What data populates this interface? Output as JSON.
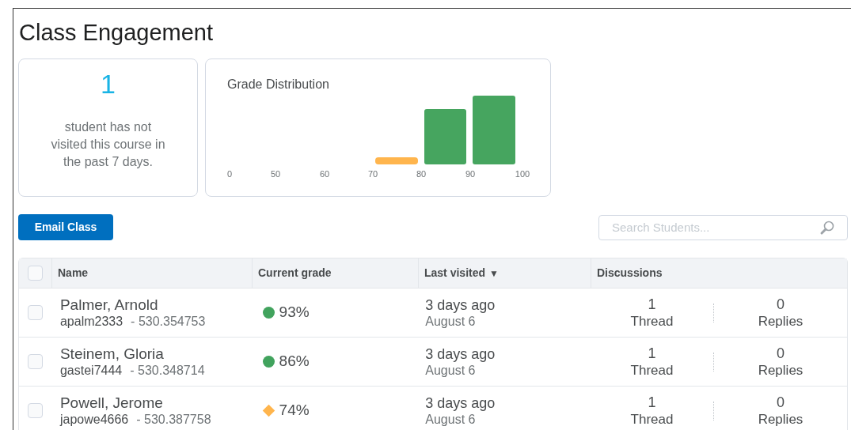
{
  "title": "Class Engagement",
  "inactive_card": {
    "count": "1",
    "text": "student has not visited this course in the past 7 days."
  },
  "grade_distribution": {
    "title": "Grade Distribution",
    "axis_labels": [
      "0",
      "50",
      "60",
      "70",
      "80",
      "90",
      "100"
    ]
  },
  "email_button": "Email Class",
  "search": {
    "placeholder": "Search Students..."
  },
  "table": {
    "select_all_checked": false,
    "columns": [
      {
        "label": "Name"
      },
      {
        "label": "Current grade"
      },
      {
        "label": "Last visited",
        "sort_mark": "▼"
      },
      {
        "label": "Discussions"
      }
    ],
    "rows": [
      {
        "checked": false,
        "name": "Palmer, Arnold",
        "username": "apalm2333",
        "id": "- 530.354753",
        "grade": "93%",
        "kind": "circle",
        "color": "#41a35d",
        "last_relative": "3 days ago",
        "last_date": "August 6",
        "threads": "1",
        "threads_label": "Thread",
        "replies": "0",
        "replies_label": "Replies"
      },
      {
        "checked": false,
        "name": "Steinem, Gloria",
        "username": "gastei7444",
        "id": "- 530.348714",
        "grade": "86%",
        "kind": "circle",
        "color": "#41a35d",
        "last_relative": "3 days ago",
        "last_date": "August 6",
        "threads": "1",
        "threads_label": "Thread",
        "replies": "0",
        "replies_label": "Replies"
      },
      {
        "checked": false,
        "name": "Powell, Jerome",
        "username": "japowe4666",
        "id": "- 530.387758",
        "grade": "74%",
        "kind": "diamond",
        "color": "#ffb54d",
        "last_relative": "3 days ago",
        "last_date": "August 6",
        "threads": "1",
        "threads_label": "Thread",
        "replies": "0",
        "replies_label": "Replies"
      }
    ]
  }
}
